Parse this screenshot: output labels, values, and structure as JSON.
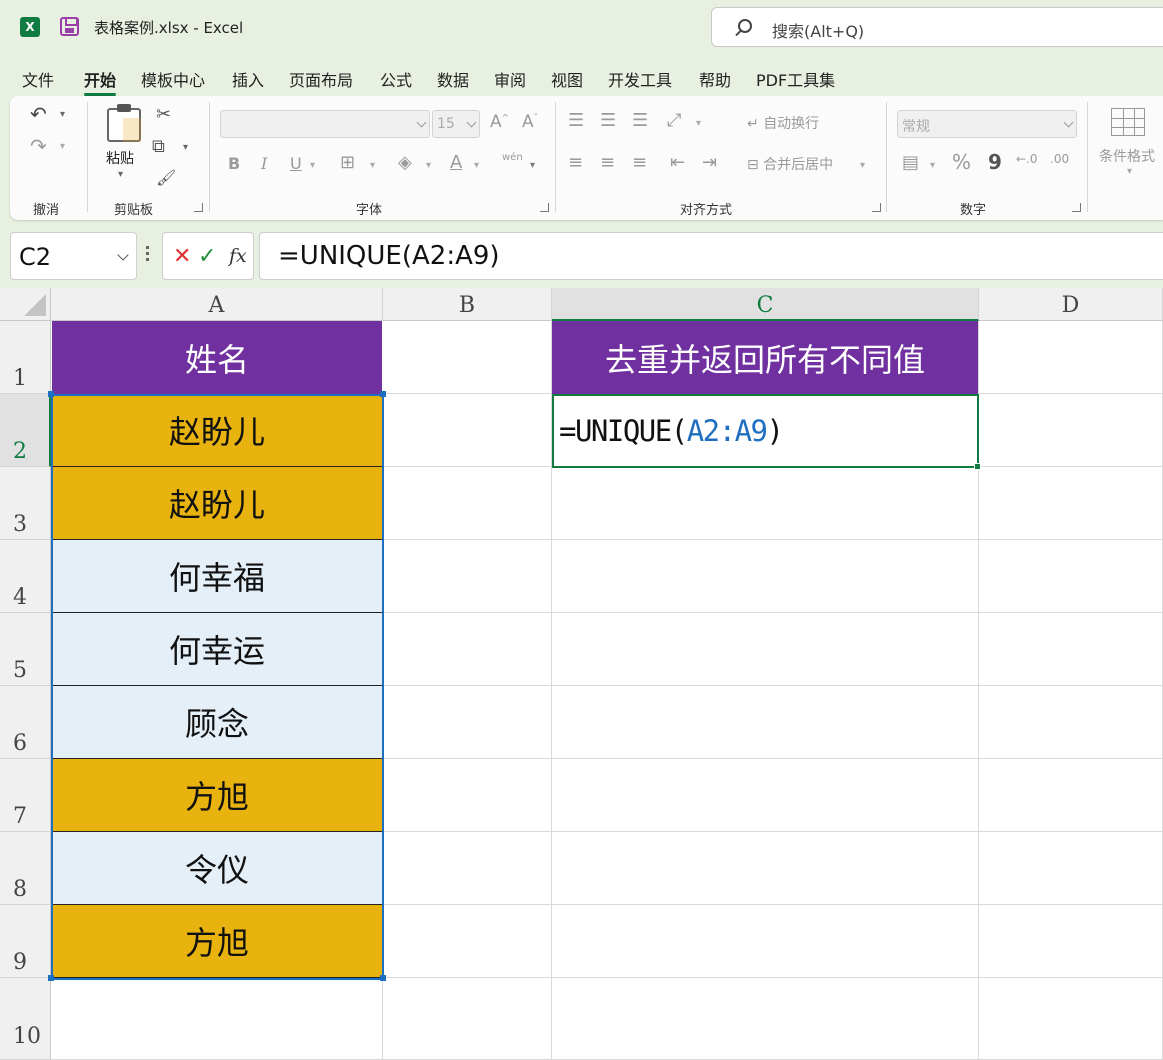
{
  "app": {
    "title": "表格案例.xlsx  -  Excel",
    "logo_letter": "X",
    "search_placeholder": "搜索(Alt+Q)"
  },
  "menu": {
    "tabs": [
      "文件",
      "开始",
      "模板中心",
      "插入",
      "页面布局",
      "公式",
      "数据",
      "审阅",
      "视图",
      "开发工具",
      "帮助",
      "PDF工具集"
    ],
    "active": "开始"
  },
  "ribbon": {
    "undo_group": "撤消",
    "clipboard_group": "剪贴板",
    "paste_label": "粘贴",
    "font_group": "字体",
    "font_size": "15",
    "align_group": "对齐方式",
    "wrap_text": "自动换行",
    "merge_center": "合并后居中",
    "number_group": "数字",
    "number_format": "常规",
    "conditional_format": "条件格式",
    "bold": "B",
    "italic": "I",
    "underline": "U",
    "percent": "%",
    "comma": "9",
    "phonetic": "wén"
  },
  "formula_bar": {
    "name_box": "C2",
    "formula": "=UNIQUE(A2:A9)"
  },
  "columns": [
    "A",
    "B",
    "C",
    "D"
  ],
  "rows": [
    "1",
    "2",
    "3",
    "4",
    "5",
    "6",
    "7",
    "8",
    "9",
    "10"
  ],
  "sheet": {
    "a1_header": "姓名",
    "c1_header": "去重并返回所有不同值",
    "names": [
      "赵盼儿",
      "赵盼儿",
      "何幸福",
      "何幸运",
      "顾念",
      "方旭",
      "令仪",
      "方旭"
    ],
    "c2_prefix": "=UNIQUE(",
    "c2_ref": "A2:A9",
    "c2_suffix": ")"
  },
  "colors": {
    "header_purple": "#7030a0",
    "gold": "#e8b30f",
    "light_blue": "#e5eff8",
    "excel_green": "#107c41",
    "ref_blue": "#1f6fc1"
  }
}
